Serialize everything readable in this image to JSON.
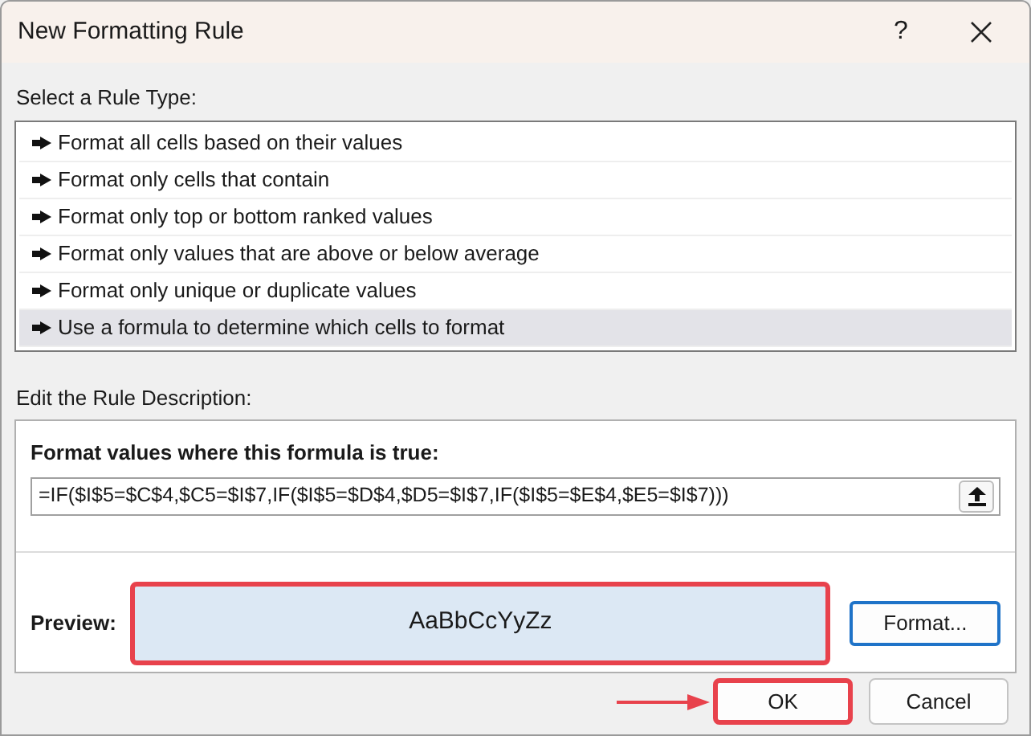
{
  "window": {
    "title": "New Formatting Rule",
    "help": "?"
  },
  "rule_type": {
    "label": "Select a Rule Type:",
    "items": [
      {
        "label": "Format all cells based on their values",
        "selected": false
      },
      {
        "label": "Format only cells that contain",
        "selected": false
      },
      {
        "label": "Format only top or bottom ranked values",
        "selected": false
      },
      {
        "label": "Format only values that are above or below average",
        "selected": false
      },
      {
        "label": "Format only unique or duplicate values",
        "selected": false
      },
      {
        "label": "Use a formula to determine which cells to format",
        "selected": true
      }
    ]
  },
  "description": {
    "label": "Edit the Rule Description:",
    "heading": "Format values where this formula is true:",
    "formula": "=IF($I$5=$C$4,$C5=$I$7,IF($I$5=$D$4,$D5=$I$7,IF($I$5=$E$4,$E5=$I$7)))"
  },
  "preview": {
    "label": "Preview:",
    "sample": "AaBbCcYyZz",
    "highlighted": true
  },
  "format_button": {
    "label": "Format...",
    "focused": true
  },
  "buttons": [
    {
      "label": "OK",
      "highlighted": true
    },
    {
      "label": "Cancel",
      "highlighted": false
    }
  ]
}
